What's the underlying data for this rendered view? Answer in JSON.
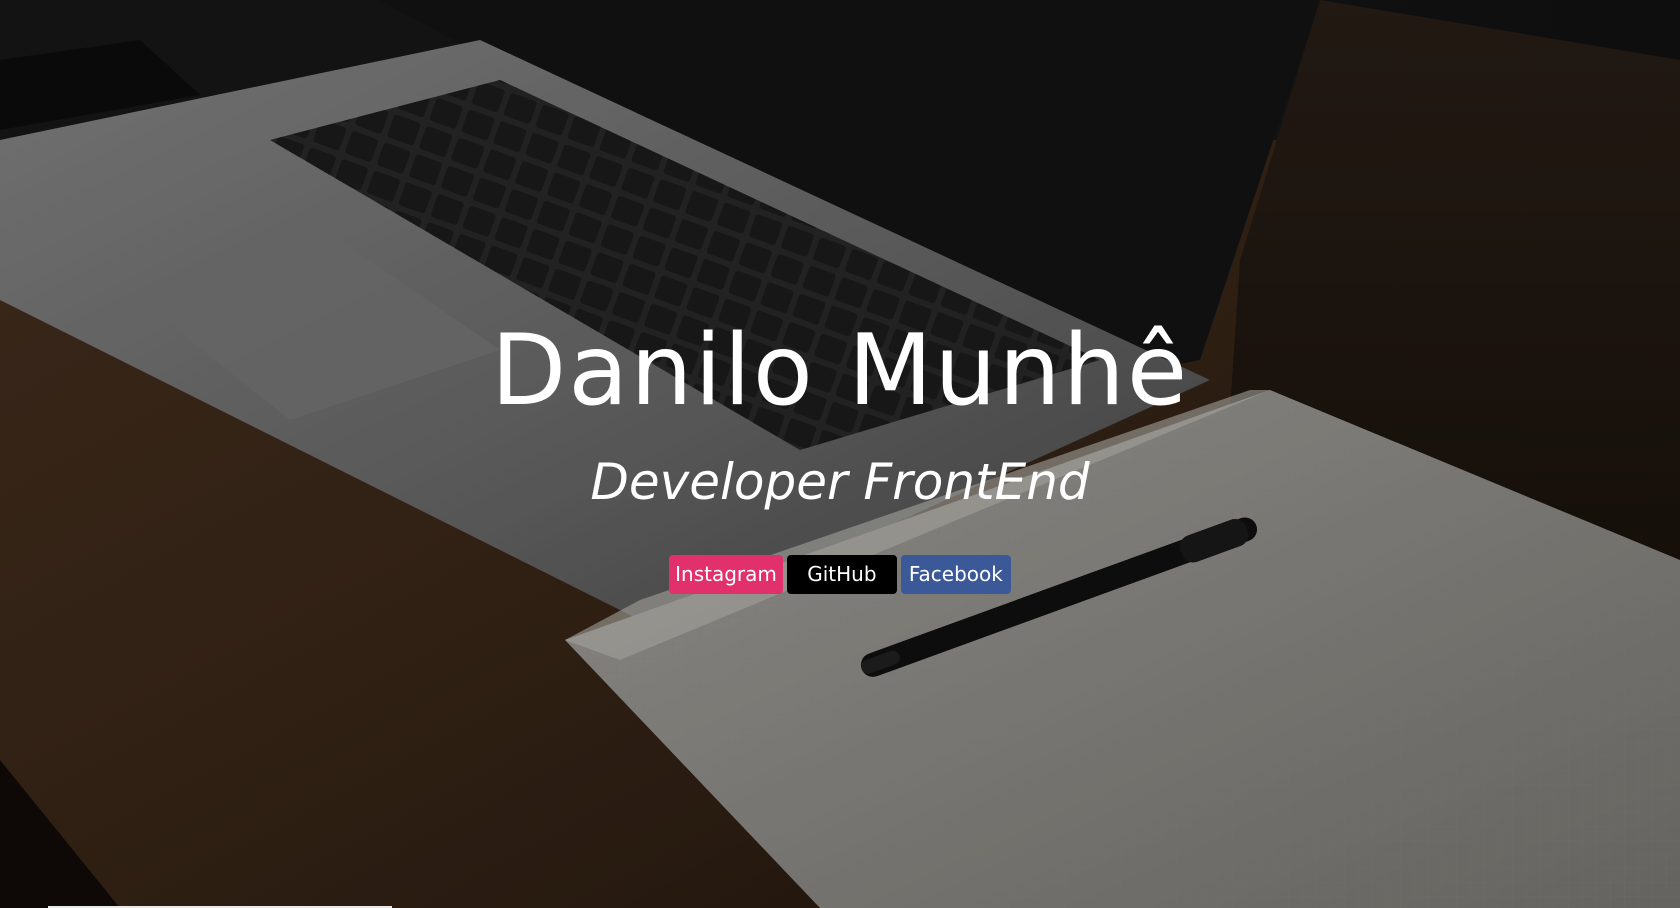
{
  "hero": {
    "title": "Danilo Munhê",
    "subtitle": "Developer FrontEnd",
    "background_description_icon": "laptop-notebook-pen-photo"
  },
  "social": [
    {
      "label": "Instagram",
      "color": "#e1306c"
    },
    {
      "label": "GitHub",
      "color": "#000000"
    },
    {
      "label": "Facebook",
      "color": "#3b5998"
    }
  ],
  "colors": {
    "overlay": "rgba(0,0,0,0.18)",
    "text": "#ffffff"
  }
}
